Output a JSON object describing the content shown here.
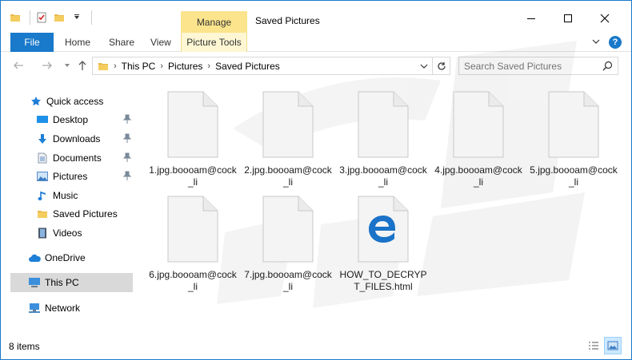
{
  "window": {
    "title": "Saved Pictures"
  },
  "contextual": {
    "manage_label": "Manage",
    "tools_label": "Picture Tools"
  },
  "ribbon": {
    "file": "File",
    "home": "Home",
    "share": "Share",
    "view": "View"
  },
  "address": {
    "crumbs": [
      "This PC",
      "Pictures",
      "Saved Pictures"
    ],
    "search_placeholder": "Search Saved Pictures"
  },
  "nav": {
    "quick_access": "Quick access",
    "items": [
      {
        "label": "Desktop",
        "icon": "desktop-icon",
        "pinned": true
      },
      {
        "label": "Downloads",
        "icon": "downloads-icon",
        "pinned": true
      },
      {
        "label": "Documents",
        "icon": "documents-icon",
        "pinned": true
      },
      {
        "label": "Pictures",
        "icon": "pictures-icon",
        "pinned": true
      },
      {
        "label": "Music",
        "icon": "music-icon",
        "pinned": false
      },
      {
        "label": "Saved Pictures",
        "icon": "folder-icon",
        "pinned": false
      },
      {
        "label": "Videos",
        "icon": "videos-icon",
        "pinned": false
      }
    ],
    "onedrive": "OneDrive",
    "thispc": "This PC",
    "network": "Network"
  },
  "files": [
    {
      "name": "1.jpg.boooam@cock_li",
      "icon": "blank-file-icon"
    },
    {
      "name": "2.jpg.boooam@cock_li",
      "icon": "blank-file-icon"
    },
    {
      "name": "3.jpg.boooam@cock_li",
      "icon": "blank-file-icon"
    },
    {
      "name": "4.jpg.boooam@cock_li",
      "icon": "blank-file-icon"
    },
    {
      "name": "5.jpg.boooam@cock_li",
      "icon": "blank-file-icon"
    },
    {
      "name": "6.jpg.boooam@cock_li",
      "icon": "blank-file-icon"
    },
    {
      "name": "7.jpg.boooam@cock_li",
      "icon": "blank-file-icon"
    },
    {
      "name": "HOW_TO_DECRYPT_FILES.html",
      "icon": "edge-html-file-icon"
    }
  ],
  "status": {
    "count": "8 items"
  },
  "colors": {
    "accent": "#1979ca",
    "manage": "#fbe48c",
    "selected": "#d9d9d9"
  }
}
